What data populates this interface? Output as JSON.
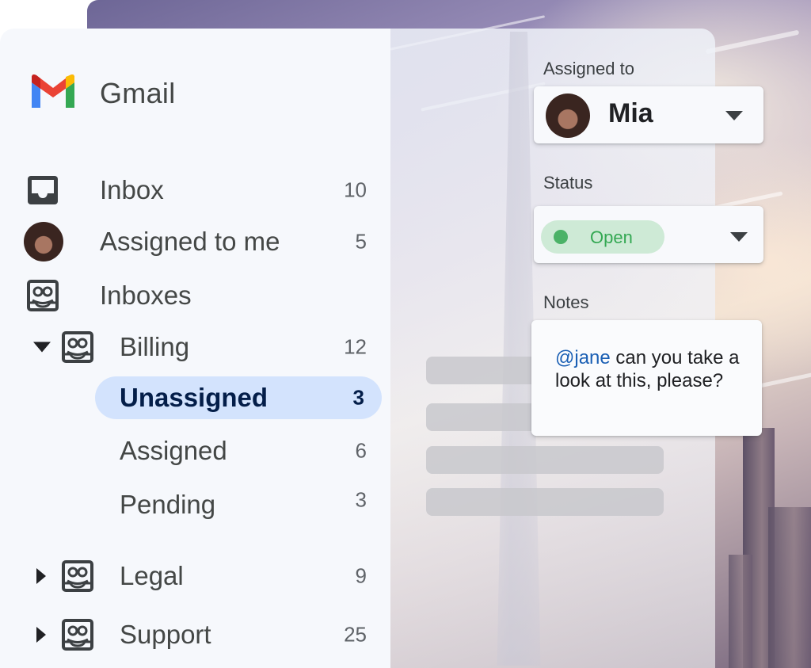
{
  "app": {
    "name": "Gmail"
  },
  "nav": {
    "inbox": {
      "label": "Inbox",
      "count": "10"
    },
    "assigned_to_me": {
      "label": "Assigned to me",
      "count": "5"
    },
    "inboxes": {
      "label": "Inboxes"
    },
    "billing": {
      "label": "Billing",
      "count": "12",
      "children": [
        {
          "label": "Unassigned",
          "count": "3",
          "selected": true
        },
        {
          "label": "Assigned",
          "count": "6"
        },
        {
          "label": "Pending",
          "count": "3"
        }
      ]
    },
    "legal": {
      "label": "Legal",
      "count": "9"
    },
    "support": {
      "label": "Support",
      "count": "25"
    }
  },
  "details": {
    "assigned_label": "Assigned to",
    "assignee": "Mia",
    "status_label": "Status",
    "status_value": "Open",
    "notes_label": "Notes",
    "note_mention": "@jane",
    "note_text": " can you take a look at this, please?"
  },
  "colors": {
    "selected_bg": "#d3e3fd",
    "status_chip": "#ceead6",
    "status_green": "#34a853",
    "mention_blue": "#1a5fb4"
  },
  "icons": {
    "inbox": "inbox-tray-icon",
    "shared_inbox": "group-inbox-icon",
    "expand": "caret-down-icon",
    "collapse": "caret-right-icon",
    "dropdown": "dropdown-arrow-icon"
  }
}
